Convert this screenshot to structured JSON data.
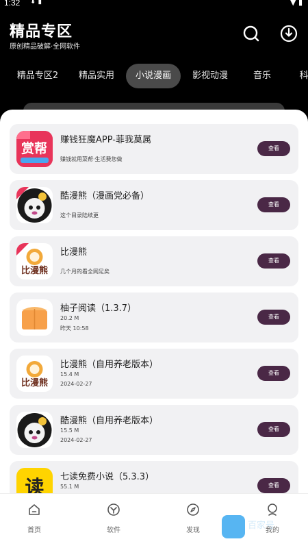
{
  "status": {
    "time": "1:32",
    "icons": "⬇ ▮",
    "right": "▼ ▮"
  },
  "header": {
    "title": "精品专区",
    "subtitle": "原创精品破解·全网软件"
  },
  "tabs": [
    {
      "label": "精品专区2"
    },
    {
      "label": "精品实用"
    },
    {
      "label": "小说漫画"
    },
    {
      "label": "影视动漫"
    },
    {
      "label": "音乐"
    },
    {
      "label": "科"
    }
  ],
  "apps": [
    {
      "title": "赚钱狂魔APP-菲我莫属",
      "desc": "赚钱就用菜帮·生活费您做",
      "button": "查看",
      "icon": "zhuanqian-app-icon"
    },
    {
      "title": "酷漫熊（漫画党必备）",
      "desc": "这个目录陆续更",
      "button": "查看",
      "icon": "kumanxiong-app-icon"
    },
    {
      "title": "比漫熊",
      "desc": "几个月的看全网足矣",
      "button": "查看",
      "icon": "bimanxiong-app-icon"
    },
    {
      "title": "柚子阅读（1.3.7）",
      "size": "20.2 M",
      "date": "昨天 10:58",
      "button": "查看",
      "icon": "youzi-app-icon"
    },
    {
      "title": "比漫熊（自用养老版本）",
      "size": "15.4 M",
      "date": "2024-02-27",
      "button": "查看",
      "icon": "bimanxiong-app-icon"
    },
    {
      "title": "酷漫熊（自用养老版本）",
      "size": "15.5 M",
      "date": "2024-02-27",
      "button": "查看",
      "icon": "kumanxiong-app-icon"
    },
    {
      "title": "七读免费小说（5.3.3）",
      "size": "55.1 M",
      "date": "",
      "button": "查看",
      "icon": "qidu-app-icon"
    }
  ],
  "bottom_nav": [
    {
      "label": "首页",
      "icon": "home-icon"
    },
    {
      "label": "软件",
      "icon": "software-icon"
    },
    {
      "label": "发现",
      "icon": "compass-icon"
    },
    {
      "label": "我的",
      "icon": "profile-icon"
    }
  ],
  "watermark": {
    "text": "百家号"
  },
  "colors": {
    "accent": "#4a2846",
    "background": "#000000",
    "card": "#f1f1f3"
  }
}
